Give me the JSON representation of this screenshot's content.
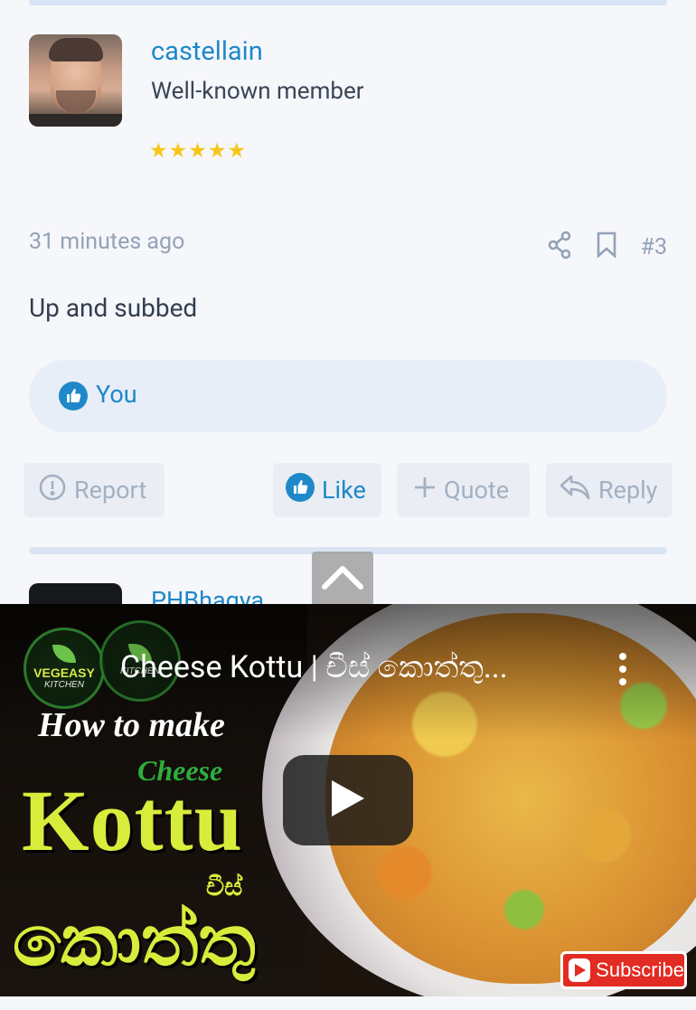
{
  "post": {
    "username": "castellain",
    "user_title": "Well-known member",
    "stars": "★★★★★",
    "timestamp": "31 minutes ago",
    "post_number": "#3",
    "message": "Up and subbed",
    "reaction_text": "You",
    "buttons": {
      "report": "Report",
      "like": "Like",
      "quote": "Quote",
      "reply": "Reply"
    }
  },
  "next_post": {
    "username": "PHBhagya"
  },
  "video": {
    "title": "Cheese Kottu | චීස් කොත්තු...",
    "channel_logo_text": "VEGEASY",
    "channel_logo_sub": "KITCHEN",
    "thumbnail": {
      "how_to": "How to make",
      "cheese": "Cheese",
      "kottu": "Kottu",
      "sinhala_small": "චීස්",
      "sinhala_big": "කොත්තු"
    },
    "subscribe_label": "Subscribe"
  },
  "colors": {
    "accent": "#1e88c9",
    "muted": "#94a2b6",
    "star": "#f7c61c",
    "youtube_red": "#e22b22"
  },
  "icons": [
    "share-icon",
    "bookmark-icon",
    "like-icon",
    "report-icon",
    "plus-icon",
    "reply-icon",
    "chevron-up-icon",
    "play-icon",
    "more-vert-icon",
    "youtube-icon"
  ]
}
